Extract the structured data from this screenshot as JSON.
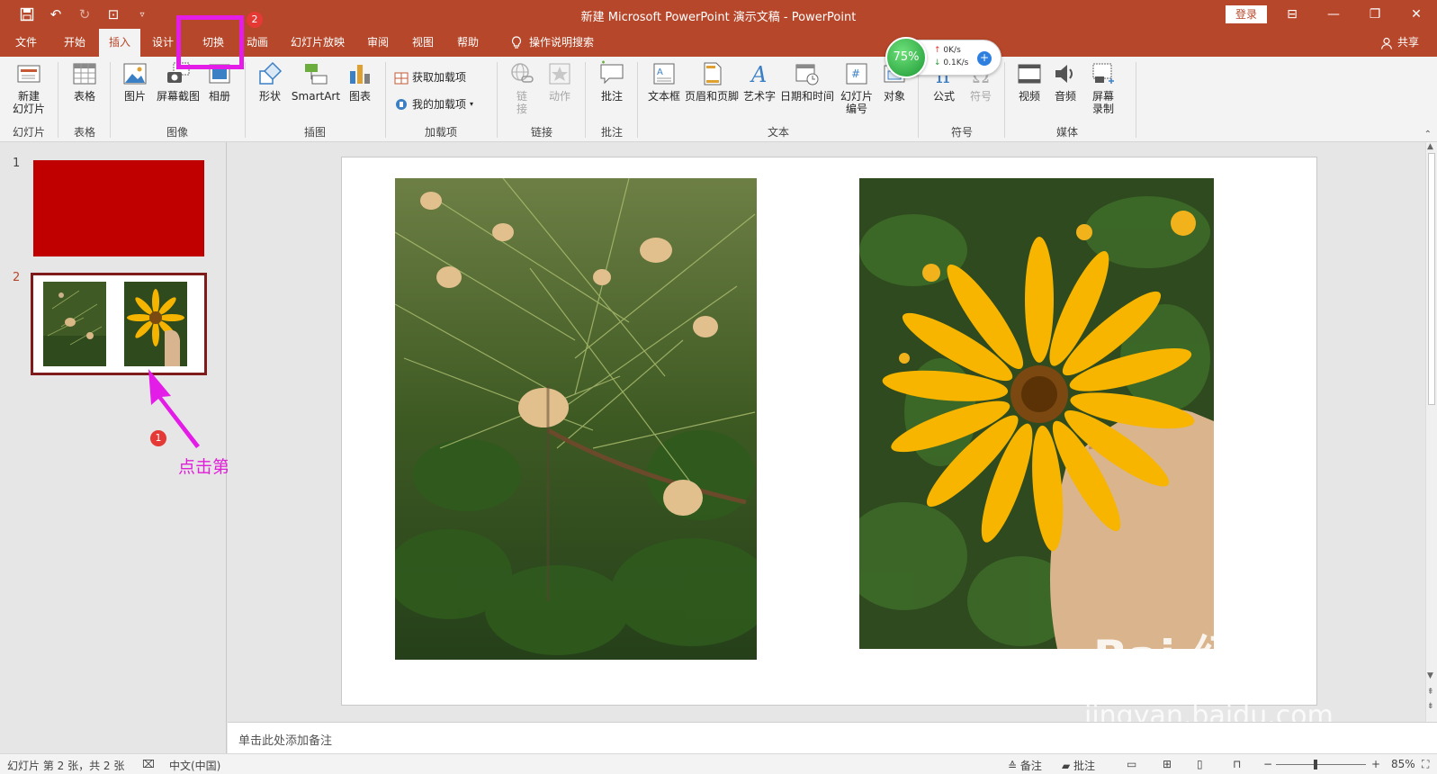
{
  "window": {
    "title": "新建 Microsoft PowerPoint 演示文稿  -  PowerPoint",
    "signin": "登录",
    "share": "共享"
  },
  "tabs": [
    "文件",
    "开始",
    "插入",
    "设计",
    "切换",
    "动画",
    "幻灯片放映",
    "审阅",
    "视图",
    "帮助"
  ],
  "active_tab": "插入",
  "tell_me": "操作说明搜索",
  "ribbon": {
    "new_slide": "新建\n幻灯片",
    "table": "表格",
    "picture": "图片",
    "screenshot": "屏幕截图",
    "album": "相册",
    "shapes": "形状",
    "smartart": "SmartArt",
    "chart": "图表",
    "get_addins": "获取加载项",
    "my_addins": "我的加载项",
    "link": "链\n接",
    "action": "动作",
    "comment": "批注",
    "textbox": "文本框",
    "header_footer": "页眉和页脚",
    "wordart": "艺术字",
    "datetime": "日期和时间",
    "slide_number": "幻灯片\n编号",
    "object": "对象",
    "equation": "公式",
    "symbol": "符号",
    "video": "视频",
    "audio": "音频",
    "screen_record": "屏幕\n录制",
    "groups": {
      "slides": "幻灯片",
      "tables": "表格",
      "images": "图像",
      "illustrations": "插图",
      "addins": "加载项",
      "links": "链接",
      "comments": "批注",
      "text": "文本",
      "symbols": "符号",
      "media": "媒体"
    }
  },
  "net_widget": {
    "percent": "75%",
    "up": "0K/s",
    "down": "0.1K/s"
  },
  "thumbnails": [
    {
      "number": "1",
      "color": "#c00000"
    },
    {
      "number": "2",
      "color": "#ffffff"
    }
  ],
  "annotations": {
    "step1": "1",
    "step2": "2",
    "step1_text": "点击第二页幻灯片",
    "accent": "#e31ce8"
  },
  "notes_placeholder": "单击此处添加备注",
  "status": {
    "slide_info": "幻灯片 第 2 张，共 2 张",
    "language": "中文(中国)",
    "notes": "备注",
    "comments": "批注",
    "zoom": "85%"
  },
  "watermark": {
    "brand": "Bai  经验",
    "url": "jingyan.baidu.com"
  },
  "colors": {
    "brand": "#b7472a",
    "ribbon": "#f3f3f3"
  }
}
